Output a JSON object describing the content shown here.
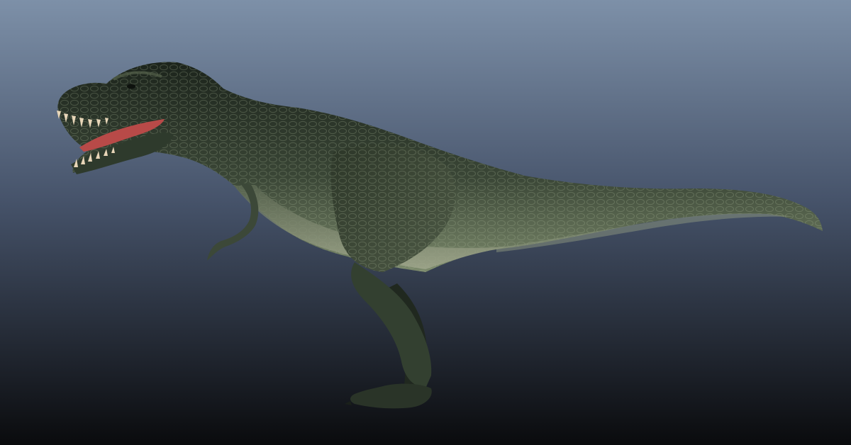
{
  "scene": {
    "subject": "t-rex-3d-model",
    "background_top": "#7d90a8",
    "background_bottom": "#0a0b0d",
    "skin_dark": "#1c241c",
    "skin_mid": "#3a4636",
    "skin_light": "#7c8a6c",
    "mouth_color": "#b84a48",
    "teeth_color": "#e8d6b8"
  }
}
